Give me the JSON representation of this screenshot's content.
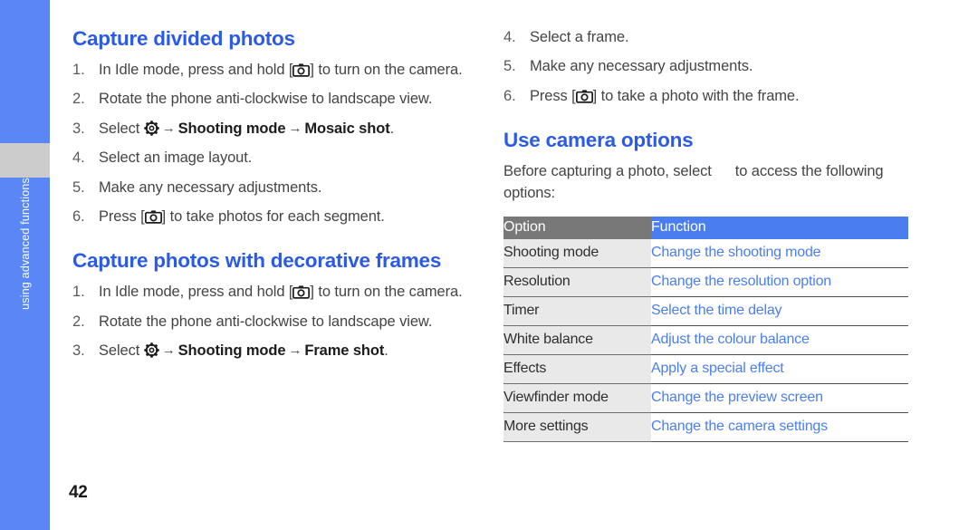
{
  "side_tab": {
    "label": "using advanced functions",
    "color": "#5b86f5",
    "gap_color": "#cccccc"
  },
  "page_number": "42",
  "accent_heading_color": "#2b5ae8",
  "left_column": {
    "sections": [
      {
        "heading": "Capture divided photos",
        "steps": [
          {
            "num": "1.",
            "parts": [
              {
                "t": "text",
                "v": "In Idle mode, press and hold ["
              },
              {
                "t": "icon",
                "v": "camera-icon"
              },
              {
                "t": "text",
                "v": "] to turn on the camera."
              }
            ]
          },
          {
            "num": "2.",
            "parts": [
              {
                "t": "text",
                "v": "Rotate the phone anti-clockwise to landscape view."
              }
            ]
          },
          {
            "num": "3.",
            "parts": [
              {
                "t": "text",
                "v": "Select "
              },
              {
                "t": "icon",
                "v": "gear-icon"
              },
              {
                "t": "arrow",
                "v": "→"
              },
              {
                "t": "bold",
                "v": "Shooting mode"
              },
              {
                "t": "arrow",
                "v": "→"
              },
              {
                "t": "bold",
                "v": "Mosaic shot"
              },
              {
                "t": "text",
                "v": "."
              }
            ]
          },
          {
            "num": "4.",
            "parts": [
              {
                "t": "text",
                "v": "Select an image layout."
              }
            ]
          },
          {
            "num": "5.",
            "parts": [
              {
                "t": "text",
                "v": "Make any necessary adjustments."
              }
            ]
          },
          {
            "num": "6.",
            "parts": [
              {
                "t": "text",
                "v": "Press ["
              },
              {
                "t": "icon",
                "v": "camera-icon"
              },
              {
                "t": "text",
                "v": "] to take photos for each segment."
              }
            ]
          }
        ]
      },
      {
        "heading": "Capture photos with decorative frames",
        "steps": [
          {
            "num": "1.",
            "parts": [
              {
                "t": "text",
                "v": "In Idle mode, press and hold ["
              },
              {
                "t": "icon",
                "v": "camera-icon"
              },
              {
                "t": "text",
                "v": "] to turn on the camera."
              }
            ]
          },
          {
            "num": "2.",
            "parts": [
              {
                "t": "text",
                "v": "Rotate the phone anti-clockwise to landscape view."
              }
            ]
          },
          {
            "num": "3.",
            "parts": [
              {
                "t": "text",
                "v": "Select "
              },
              {
                "t": "icon",
                "v": "gear-icon"
              },
              {
                "t": "arrow",
                "v": "→"
              },
              {
                "t": "bold",
                "v": "Shooting mode"
              },
              {
                "t": "arrow",
                "v": "→"
              },
              {
                "t": "bold",
                "v": "Frame shot"
              },
              {
                "t": "text",
                "v": "."
              }
            ]
          }
        ]
      }
    ]
  },
  "right_column": {
    "continued_steps": [
      {
        "num": "4.",
        "parts": [
          {
            "t": "text",
            "v": "Select a frame."
          }
        ]
      },
      {
        "num": "5.",
        "parts": [
          {
            "t": "text",
            "v": "Make any necessary adjustments."
          }
        ]
      },
      {
        "num": "6.",
        "parts": [
          {
            "t": "text",
            "v": "Press ["
          },
          {
            "t": "icon",
            "v": "camera-icon"
          },
          {
            "t": "text",
            "v": "] to take a photo with the frame."
          }
        ]
      }
    ],
    "section": {
      "heading": "Use camera options",
      "intro_before": "Before capturing a photo, select ",
      "intro_icon": "gear-icon",
      "intro_after": " to access the following options:"
    },
    "options_table": {
      "header": {
        "option": "Option",
        "function": "Function"
      },
      "header_option_bg": "#787878",
      "header_function_bg": "#4a7ef0",
      "function_text_color": "#4a7ef0",
      "rows": [
        {
          "option": "Shooting mode",
          "function": "Change the shooting mode"
        },
        {
          "option": "Resolution",
          "function": "Change the resolution option"
        },
        {
          "option": "Timer",
          "function": "Select the time delay"
        },
        {
          "option": "White balance",
          "function": "Adjust the colour balance"
        },
        {
          "option": "Effects",
          "function": "Apply a special effect"
        },
        {
          "option": "Viewfinder mode",
          "function": "Change the preview screen"
        },
        {
          "option": "More settings",
          "function": "Change the camera settings"
        }
      ]
    }
  }
}
